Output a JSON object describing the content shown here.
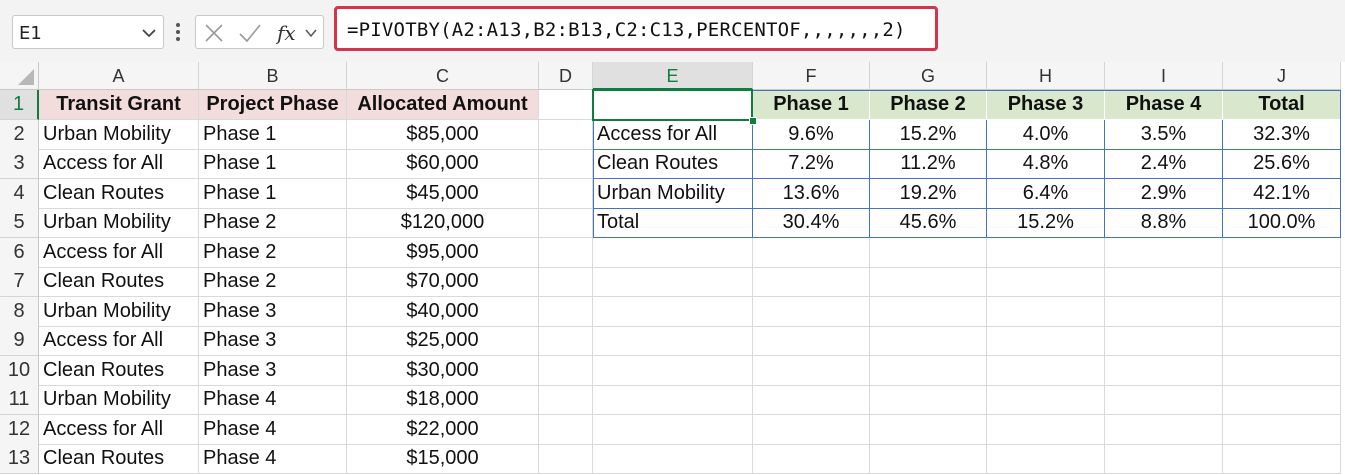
{
  "name_box": "E1",
  "formula": "=PIVOTBY(A2:A13,B2:B13,C2:C13,PERCENTOF,,,,,,,2)",
  "columns": [
    "A",
    "B",
    "C",
    "D",
    "E",
    "F",
    "G",
    "H",
    "I",
    "J"
  ],
  "rows": [
    "1",
    "2",
    "3",
    "4",
    "5",
    "6",
    "7",
    "8",
    "9",
    "10",
    "11",
    "12",
    "13"
  ],
  "source": {
    "headers": [
      "Transit Grant",
      "Project Phase",
      "Allocated Amount"
    ],
    "data": [
      [
        "Urban Mobility",
        "Phase 1",
        "$85,000"
      ],
      [
        "Access for All",
        "Phase 1",
        "$60,000"
      ],
      [
        "Clean Routes",
        "Phase 1",
        "$45,000"
      ],
      [
        "Urban Mobility",
        "Phase 2",
        "$120,000"
      ],
      [
        "Access for All",
        "Phase 2",
        "$95,000"
      ],
      [
        "Clean Routes",
        "Phase 2",
        "$70,000"
      ],
      [
        "Urban Mobility",
        "Phase 3",
        "$40,000"
      ],
      [
        "Access for All",
        "Phase 3",
        "$25,000"
      ],
      [
        "Clean Routes",
        "Phase 3",
        "$30,000"
      ],
      [
        "Urban Mobility",
        "Phase 4",
        "$18,000"
      ],
      [
        "Access for All",
        "Phase 4",
        "$22,000"
      ],
      [
        "Clean Routes",
        "Phase 4",
        "$15,000"
      ]
    ]
  },
  "pivot": {
    "headers": [
      "",
      "Phase 1",
      "Phase 2",
      "Phase 3",
      "Phase 4",
      "Total"
    ],
    "data": [
      [
        "Access for All",
        "9.6%",
        "15.2%",
        "4.0%",
        "3.5%",
        "32.3%"
      ],
      [
        "Clean Routes",
        "7.2%",
        "11.2%",
        "4.8%",
        "2.4%",
        "25.6%"
      ],
      [
        "Urban Mobility",
        "13.6%",
        "19.2%",
        "6.4%",
        "2.9%",
        "42.1%"
      ],
      [
        "Total",
        "30.4%",
        "45.6%",
        "15.2%",
        "8.8%",
        "100.0%"
      ]
    ]
  },
  "colors": {
    "formula_border": "#d5334b",
    "source_header_fill": "#f3dcdc",
    "pivot_header_fill": "#d9e8cc",
    "pivot_border": "#4472c4",
    "selection": "#107c41"
  },
  "icons": [
    "chevron-down-icon",
    "more-options-icon",
    "cancel-icon",
    "enter-icon",
    "function-icon"
  ]
}
